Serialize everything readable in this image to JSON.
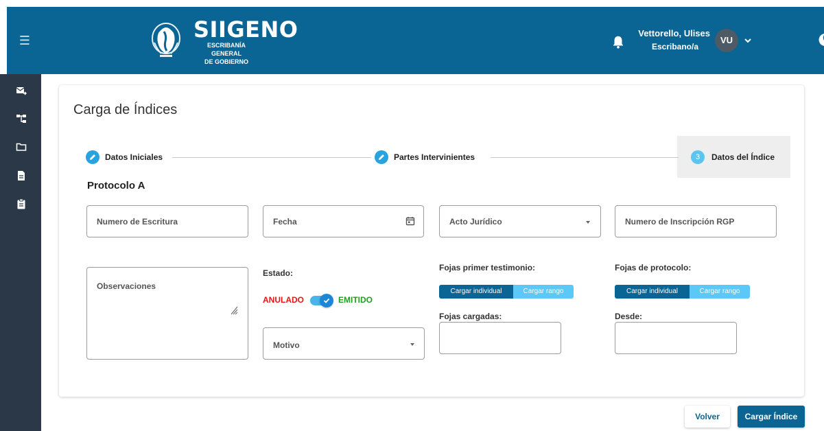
{
  "header": {
    "brand_title": "SIIGENO",
    "brand_sub_line1": "ESCRIBANÍA GENERAL",
    "brand_sub_line2": "DE GOBIERNO",
    "user_name": "Vettorello, Ulises",
    "user_role": "Escribano/a",
    "avatar_initials": "VU",
    "icons": [
      "menu-icon",
      "logo-emblem",
      "bell-icon",
      "chevron-down-icon",
      "moon-icon"
    ]
  },
  "sidebar": {
    "icons": [
      "mail-forward-icon",
      "tree-icon",
      "folder-icon",
      "document-icon",
      "clipboard-icon"
    ]
  },
  "page": {
    "title": "Carga de Índices"
  },
  "stepper": {
    "steps": [
      {
        "label": "Datos Iniciales",
        "status": "done"
      },
      {
        "label": "Partes Intervinientes",
        "status": "done"
      },
      {
        "label": "Datos del Índice",
        "status": "active",
        "number": "3"
      }
    ]
  },
  "form": {
    "section_title": "Protocolo A",
    "numero_escritura": "Numero de Escritura",
    "fecha": "Fecha",
    "acto_juridico": "Acto Jurídico",
    "numero_inscripcion": "Numero de Inscripción RGP",
    "observaciones": "Observaciones",
    "estado_label": "Estado:",
    "estado_off": "ANULADO",
    "estado_on": "EMITIDO",
    "estado_value": "EMITIDO",
    "motivo": "Motivo",
    "fojas_testimonio_label": "Fojas primer testimonio:",
    "fojas_testimonio_btn_individual": "Cargar individual",
    "fojas_testimonio_btn_rango": "Cargar rango",
    "fojas_cargadas_label": "Fojas cargadas:",
    "fojas_protocolo_label": "Fojas de protocolo:",
    "fojas_protocolo_btn_individual": "Cargar individual",
    "fojas_protocolo_btn_rango": "Cargar rango",
    "desde_label": "Desde:"
  },
  "actions": {
    "volver": "Volver",
    "cargar": "Cargar Índice"
  },
  "colors": {
    "header_bg": "#0a6494",
    "sidebar_bg": "#2b3848",
    "accent": "#29a3de",
    "anulado": "#ee1111",
    "emitido": "#1ea01e"
  }
}
